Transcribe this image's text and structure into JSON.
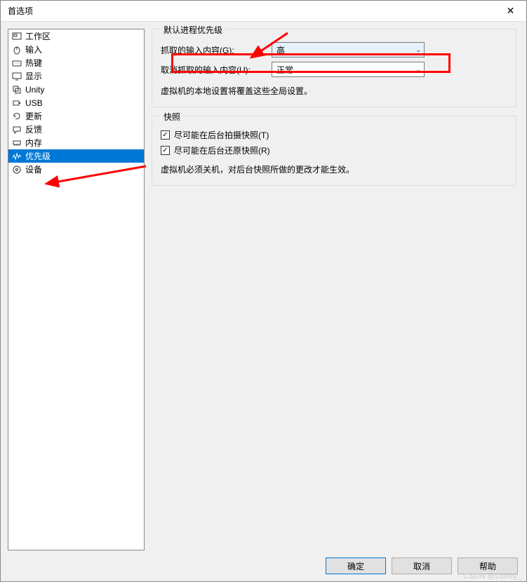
{
  "window": {
    "title": "首选项"
  },
  "sidebar": {
    "items": [
      {
        "icon": "workspace-icon",
        "label": "工作区"
      },
      {
        "icon": "input-icon",
        "label": "输入"
      },
      {
        "icon": "hotkey-icon",
        "label": "热键"
      },
      {
        "icon": "display-icon",
        "label": "显示"
      },
      {
        "icon": "unity-icon",
        "label": "Unity"
      },
      {
        "icon": "usb-icon",
        "label": "USB"
      },
      {
        "icon": "update-icon",
        "label": "更新"
      },
      {
        "icon": "feedback-icon",
        "label": "反馈"
      },
      {
        "icon": "memory-icon",
        "label": "内存"
      },
      {
        "icon": "priority-icon",
        "label": "优先级"
      },
      {
        "icon": "device-icon",
        "label": "设备"
      }
    ],
    "selected_index": 9
  },
  "priority_group": {
    "title": "默认进程优先级",
    "grabbed_label": "抓取的输入内容(G):",
    "grabbed_value": "高",
    "ungrabbed_label": "取消抓取的输入内容(U):",
    "ungrabbed_value": "正常",
    "hint": "虚拟机的本地设置将覆盖这些全局设置。"
  },
  "snapshot_group": {
    "title": "快照",
    "bg_take_label": "尽可能在后台拍摄快照(T)",
    "bg_take_checked": true,
    "bg_restore_label": "尽可能在后台还原快照(R)",
    "bg_restore_checked": true,
    "hint": "虚拟机必须关机，对后台快照所做的更改才能生效。"
  },
  "buttons": {
    "ok": "确定",
    "cancel": "取消",
    "help": "帮助"
  },
  "watermark": "CSDN @Lorrey_",
  "annotation": {
    "highlight_color": "#ff0000"
  }
}
